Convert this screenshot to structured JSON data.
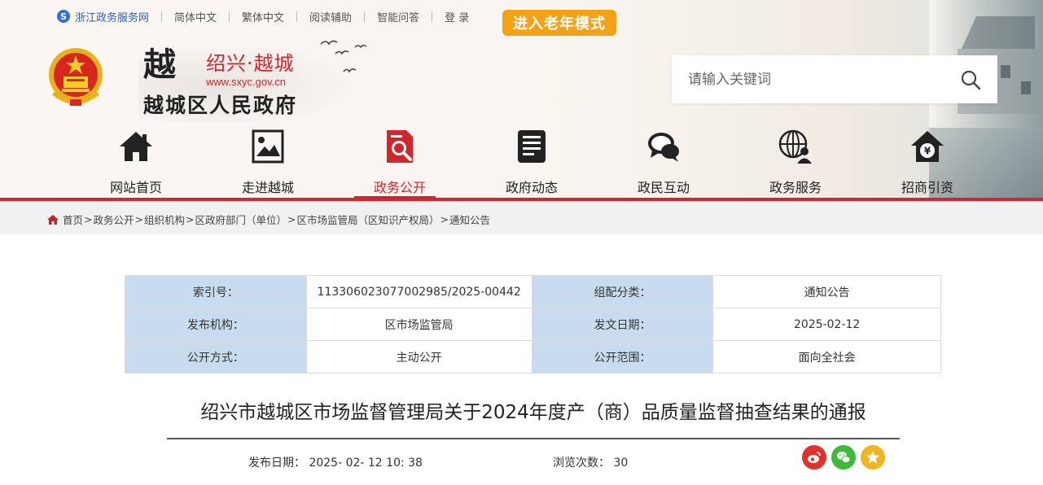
{
  "topbar": {
    "zj_service": "浙江政务服务网",
    "links": [
      "简体中文",
      "繁体中文",
      "阅读辅助",
      "智能问答",
      "登 录"
    ],
    "elder_mode": "进入老年模式"
  },
  "logo": {
    "mark": "越",
    "city": "绍兴·越城",
    "url": "www.sxyc.gov.cn",
    "name": "越城区人民政府"
  },
  "search": {
    "placeholder": "请输入关键词"
  },
  "nav": {
    "items": [
      {
        "label": "网站首页",
        "icon": "home-icon"
      },
      {
        "label": "走进越城",
        "icon": "picture-icon"
      },
      {
        "label": "政务公开",
        "icon": "document-search-icon",
        "active": true
      },
      {
        "label": "政府动态",
        "icon": "news-icon"
      },
      {
        "label": "政民互动",
        "icon": "chat-icon"
      },
      {
        "label": "政务服务",
        "icon": "globe-person-icon"
      },
      {
        "label": "招商引资",
        "icon": "yuan-house-icon"
      }
    ]
  },
  "breadcrumb": [
    "首页",
    "政务公开",
    "组织机构",
    "区政府部门（单位）",
    "区市场监管局（区知识产权局）",
    "通知公告"
  ],
  "meta": {
    "rows": [
      {
        "k1": "索引号：",
        "v1": "113306023077002985/2025-00442",
        "k2": "组配分类：",
        "v2": "通知公告"
      },
      {
        "k1": "发布机构：",
        "v1": "区市场监管局",
        "k2": "发文日期：",
        "v2": "2025-02-12"
      },
      {
        "k1": "公开方式：",
        "v1": "主动公开",
        "k2": "公开范围：",
        "v2": "面向全社会"
      }
    ]
  },
  "article": {
    "title": "绍兴市越城区市场监督管理局关于2024年度产（商）品质量监督抽查结果的通报",
    "pub_label": "发布日期：",
    "pub_date": "2025- 02- 12 10: 38",
    "views_label": "浏览次数：",
    "views": "30"
  },
  "colors": {
    "brand_red": "#d0262d",
    "elder_orange": "#f3a216",
    "table_header": "#c9dcef"
  }
}
